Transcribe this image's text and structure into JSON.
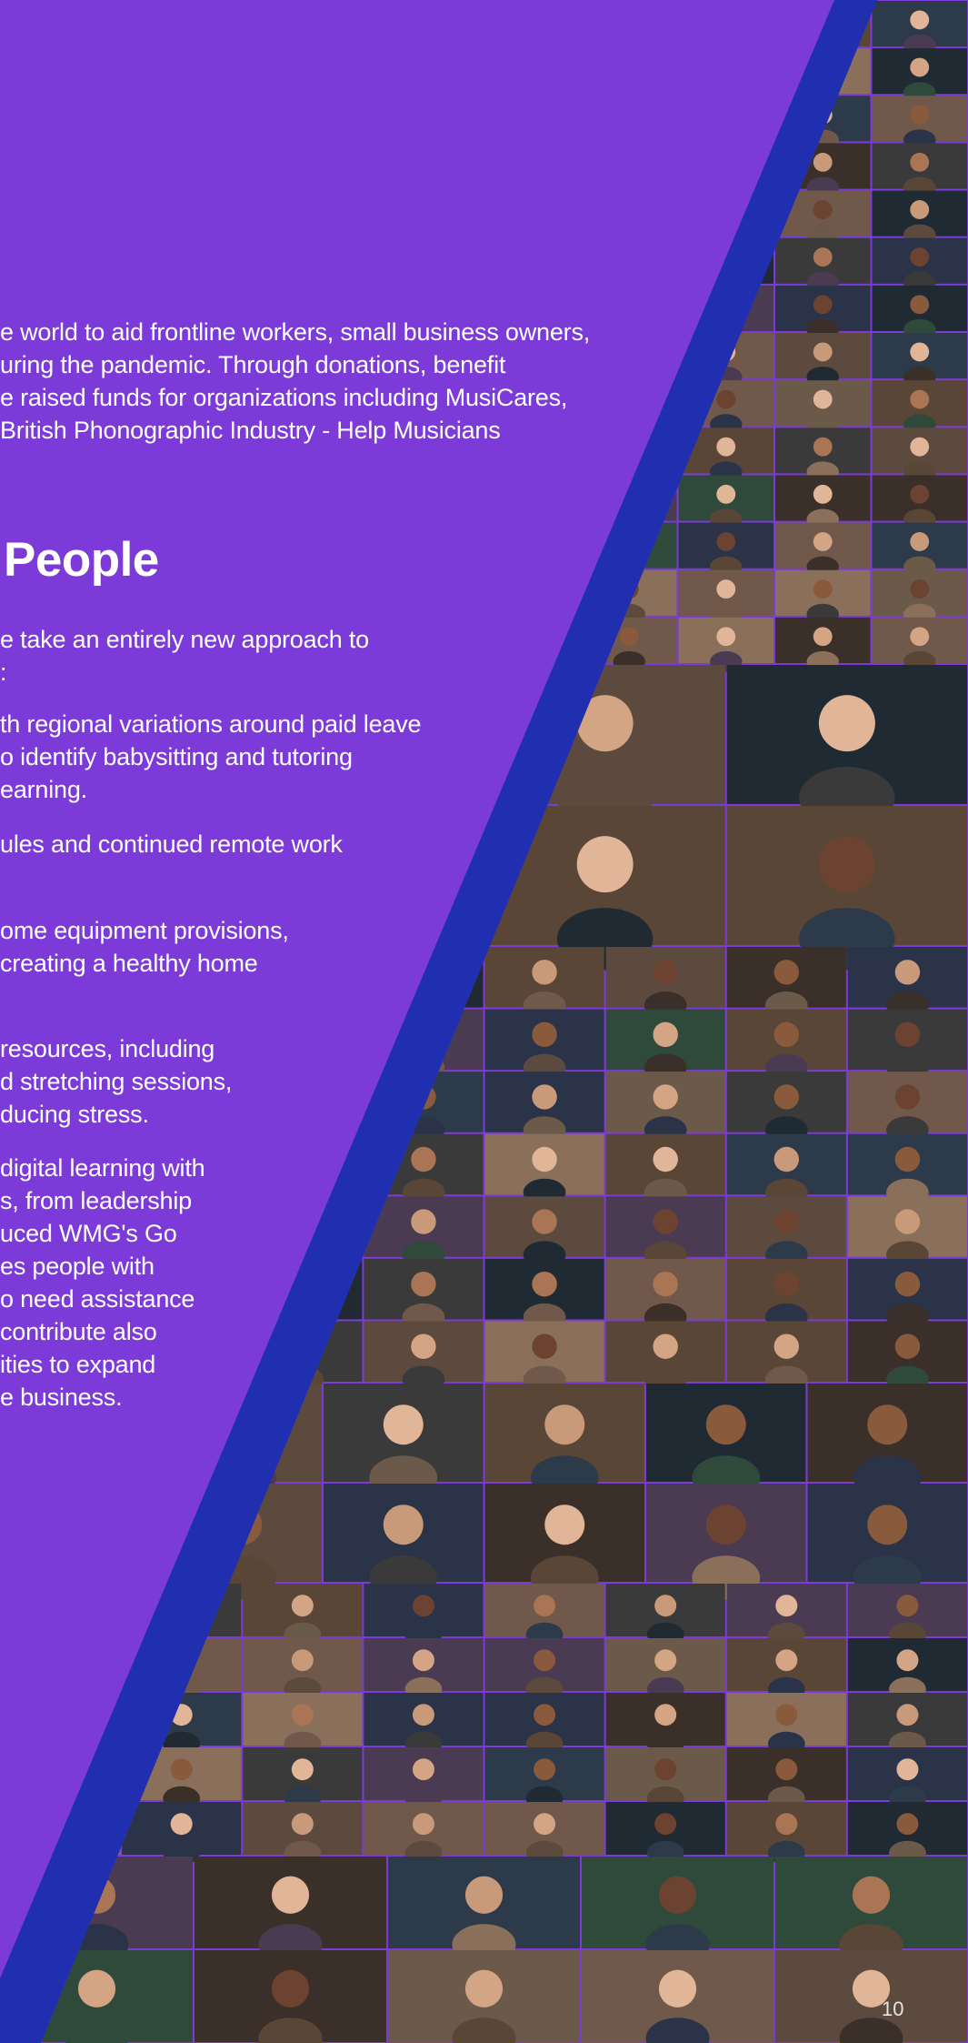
{
  "intro": {
    "lines": [
      "e world to aid frontline workers, small business owners,",
      "uring the pandemic. Through donations, benefit",
      "e raised funds for organizations including MusiCares,",
      "British Phonographic Industry - Help Musicians"
    ]
  },
  "section": {
    "heading": "People",
    "lead": [
      "e take an entirely new approach to",
      ":"
    ],
    "item1": [
      "th regional variations around paid leave",
      "o identify babysitting and tutoring",
      "earning."
    ],
    "item2": [
      "ules and continued remote work"
    ],
    "item3": [
      "ome equipment provisions,",
      "creating a healthy home"
    ],
    "item4": [
      "resources, including",
      "d stretching sessions,",
      "ducing stress."
    ],
    "item5": [
      "digital learning with",
      "s, from leadership",
      "uced WMG's Go",
      "es people with",
      "o need assistance",
      "contribute also",
      "ities to expand",
      "e business."
    ]
  },
  "page_number": "10",
  "colors": {
    "background_purple": "#7c3ad9",
    "stripe_blue": "#1f2fb0",
    "text": "#ffffff"
  }
}
